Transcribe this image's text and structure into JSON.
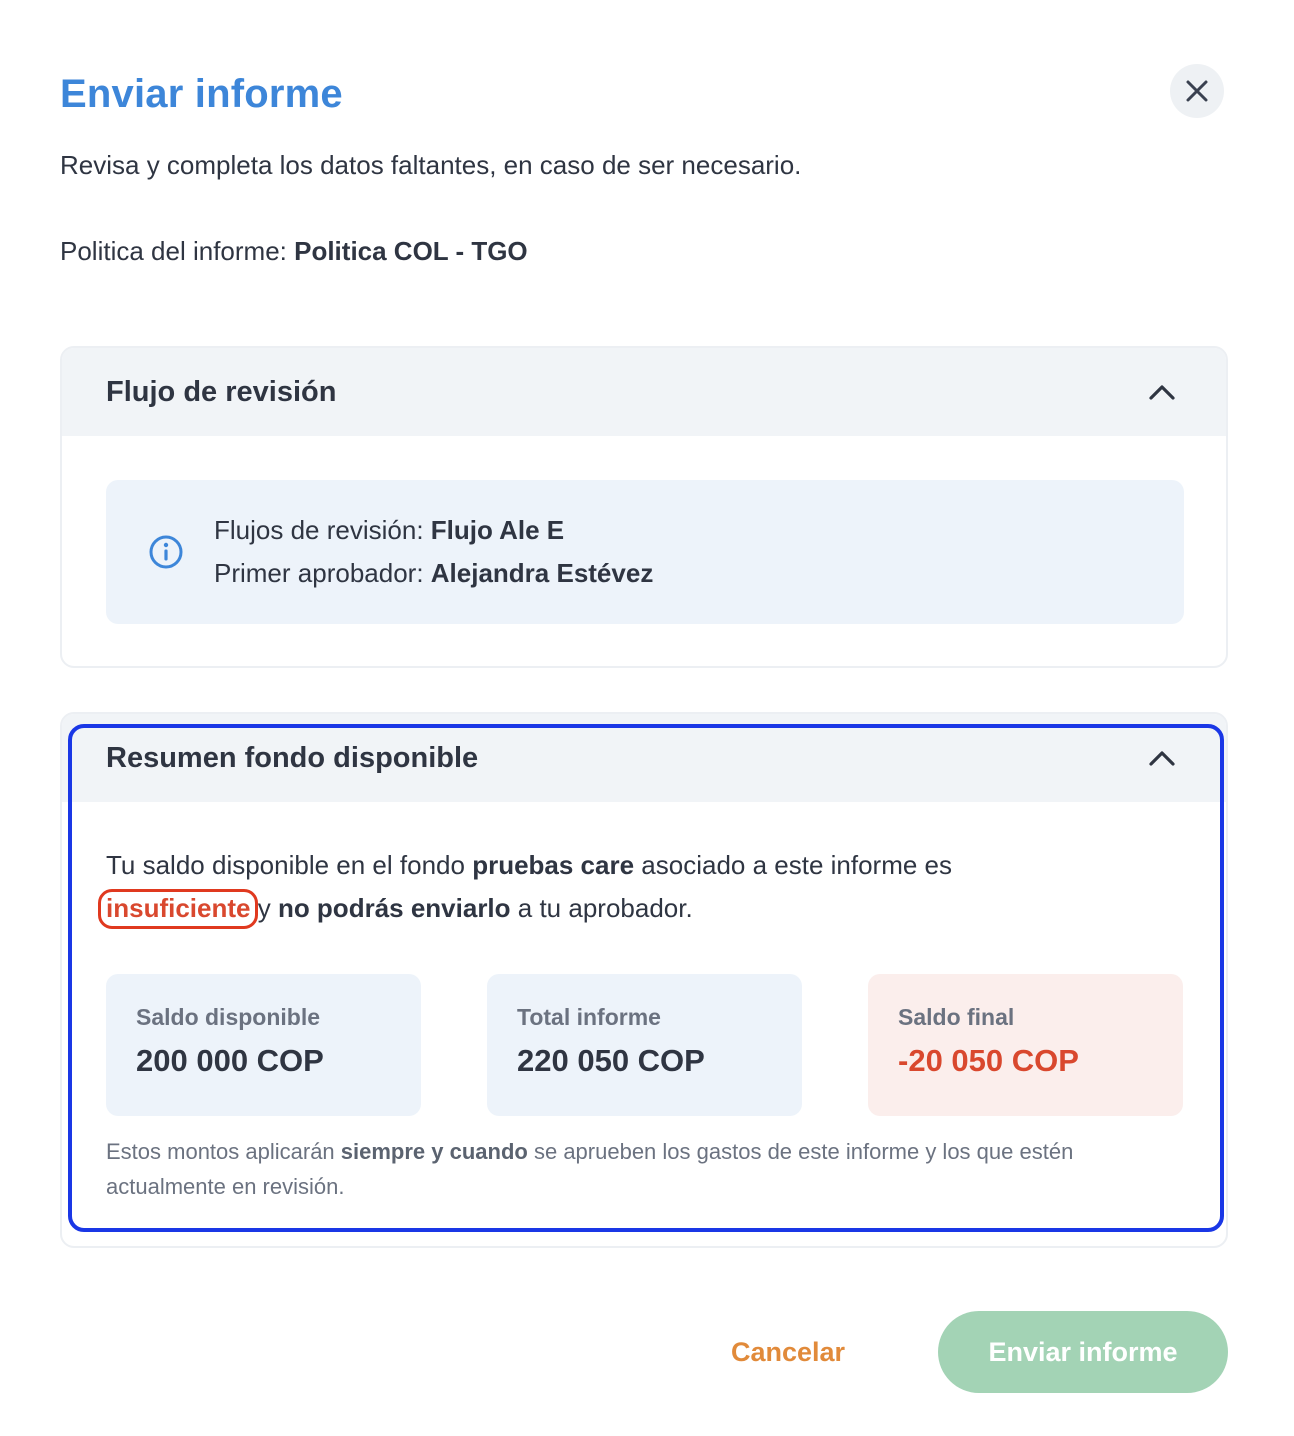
{
  "dialog": {
    "title": "Enviar informe",
    "subtitle": "Revisa y completa los datos faltantes, en caso de ser necesario.",
    "policy_label": "Politica del informe: ",
    "policy_value": "Politica COL - TGO",
    "close_icon": "close-icon"
  },
  "review_flow": {
    "title": "Flujo de revisión",
    "icon": "chevron-up-icon",
    "info_icon": "info-icon",
    "flow_label": "Flujos de revisión: ",
    "flow_value": "Flujo Ale E",
    "approver_label": "Primer aprobador: ",
    "approver_value": "Alejandra Estévez"
  },
  "fund_summary": {
    "title": "Resumen fondo disponible",
    "icon": "chevron-up-icon",
    "text_1": "Tu saldo disponible en el fondo ",
    "fund_name": "pruebas care",
    "text_2": " asociado a este informe es ",
    "status_word": "insuficiente",
    "text_3": " y ",
    "warning": "no podrás enviarlo",
    "text_4": " a tu aprobador.",
    "stats": [
      {
        "label": "Saldo disponible",
        "value": "200 000 COP"
      },
      {
        "label": "Total informe",
        "value": "220 050 COP"
      },
      {
        "label": "Saldo final",
        "value": "-20 050 COP"
      }
    ],
    "footnote_1": "Estos montos aplicarán ",
    "footnote_bold": "siempre y cuando",
    "footnote_2": " se aprueben los gastos de este informe y los que estén actualmente en revisión."
  },
  "actions": {
    "cancel_label": "Cancelar",
    "submit_label": "Enviar informe"
  },
  "colors": {
    "title_blue": "#3d86d9",
    "negative_red": "#d9482e",
    "cancel_orange": "#e18a3a",
    "submit_green_disabled": "#a3d3b5",
    "highlight_frame": "#1a37e6"
  }
}
